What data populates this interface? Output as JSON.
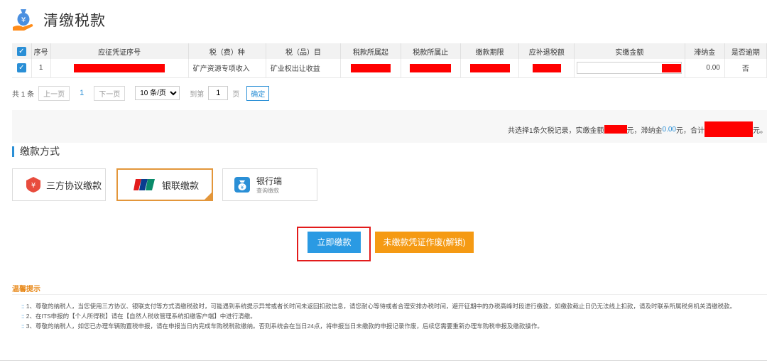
{
  "page": {
    "title": "清缴税款"
  },
  "table": {
    "headers": [
      "序号",
      "应征凭证序号",
      "税（费）种",
      "税（品）目",
      "税款所属起",
      "税款所属止",
      "缴款期限",
      "应补退税额",
      "实缴金额",
      "滞纳金",
      "是否逾期"
    ],
    "rows": [
      {
        "index": "1",
        "tax_type": "矿产资源专项收入",
        "tax_item": "矿业权出让收益",
        "late_fee": "0.00",
        "overdue": "否"
      }
    ]
  },
  "pager": {
    "total": "共 1 条",
    "prev": "上一页",
    "current": "1",
    "next": "下一页",
    "page_size": "10 条/页",
    "goto_prefix": "到第",
    "goto_value": "1",
    "goto_suffix": "页",
    "confirm": "确定"
  },
  "summary": {
    "part1": "共选择1条欠税记录，实缴金额",
    "part2": "元，滞纳金",
    "late_fee": "0.00",
    "part3": "元，合计",
    "part4": "元。"
  },
  "payment": {
    "section_title": "缴款方式",
    "options": [
      {
        "label": "三方协议缴款"
      },
      {
        "label": "银联缴款",
        "badge": "UnionPay 银联",
        "selected": true
      },
      {
        "label": "银行端",
        "sub": "查询缴款"
      }
    ]
  },
  "actions": {
    "pay_now": "立即缴款",
    "void_unpaid": "未缴款凭证作废(解锁)"
  },
  "tips": {
    "title": "温馨提示",
    "items": [
      "1、尊敬的纳税人，当您使用三方协议、银联支付等方式清缴税款时，可能遇到系统提示异常或者长时间未返回扣款信息，请您耐心等待或者合理安排办税时间，避开征期中的办税高峰时段进行缴款，如缴款截止日仍无法线上扣款，请及时联系所属税务机关清缴税款。",
      "2、在ITS申报的【个人所得税】请在【自然人税收管理系统扣缴客户端】中进行清缴。",
      "3、尊敬的纳税人，如您已办理车辆购置税申报，请在申报当日内完成车购税税款缴纳。否则系统会在当日24点，将申报当日未缴款的申报记录作废，后续您需要重新办理车购税申报及缴款操作。"
    ]
  },
  "colors": {
    "accent": "#2a8fd6",
    "orange": "#f59a13",
    "highlight": "#e21b1b",
    "redaction": "#ff0000"
  }
}
